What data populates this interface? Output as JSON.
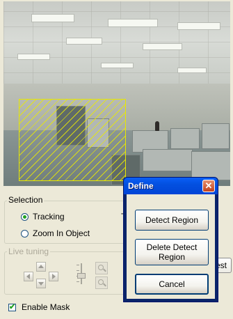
{
  "selection": {
    "label": "Selection",
    "tracking_label": "Tracking",
    "zoom_label": "Zoom In Object",
    "tracking_checked": true,
    "zoom_checked": false,
    "obscured_text": "T"
  },
  "live_tuning": {
    "label": "Live tuning",
    "behind_button_text": "est"
  },
  "enable_mask": {
    "label": "Enable Mask",
    "checked": true,
    "check_glyph": "✔"
  },
  "dialog": {
    "title": "Define",
    "close_glyph": "✕",
    "buttons": {
      "detect": "Detect Region",
      "delete": "Delete Detect Region",
      "cancel": "Cancel"
    }
  },
  "colors": {
    "mask_hatch": "#e8e800",
    "titlebar": "#0350e0",
    "close": "#c2421e"
  }
}
